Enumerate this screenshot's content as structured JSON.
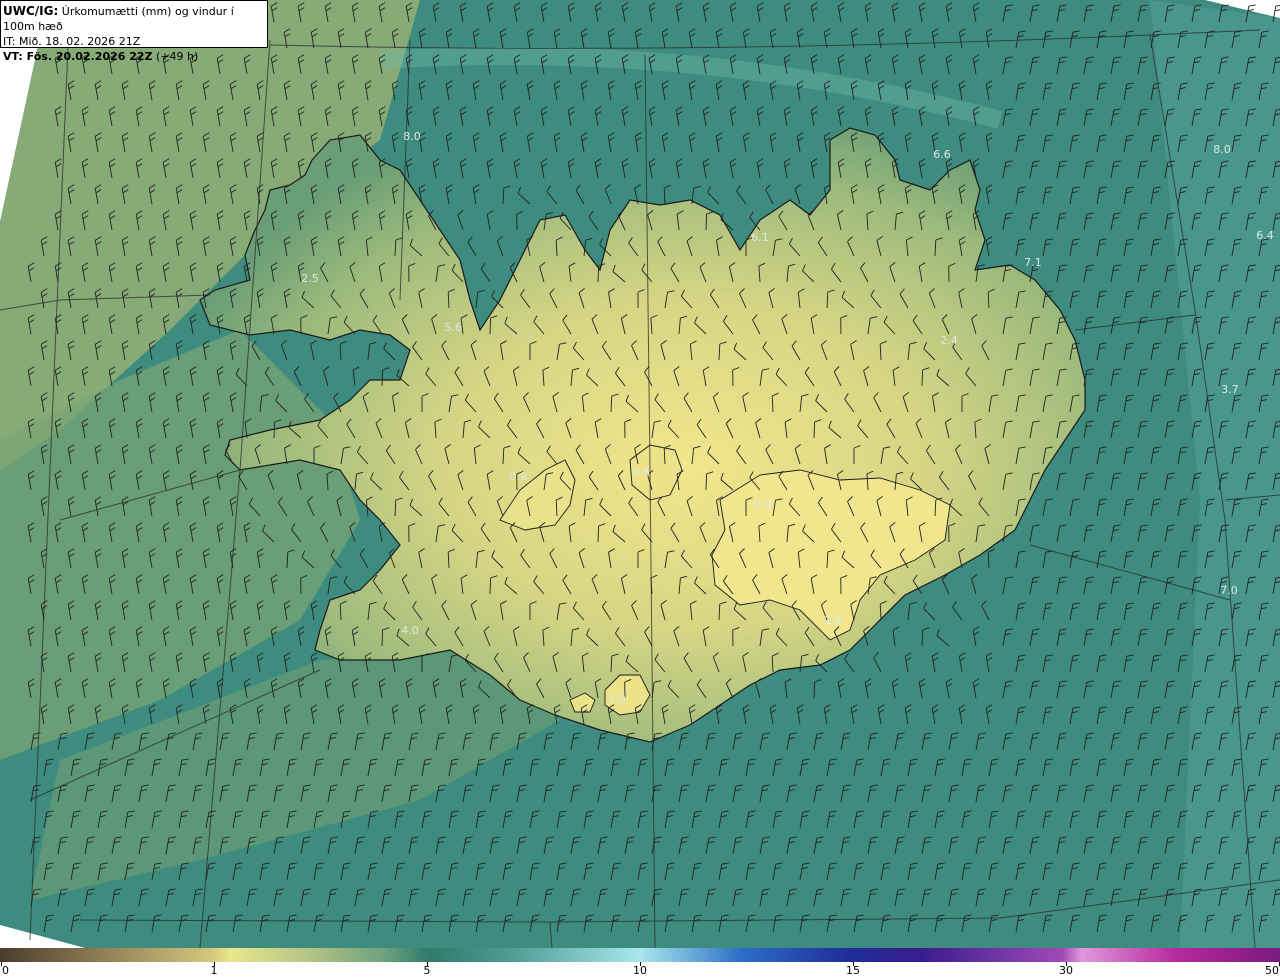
{
  "header": {
    "source": "UWC/IG:",
    "title": "Úrkomumætti (mm) og vindur í 100m hæð",
    "init_time": "IT: Mið. 18. 02. 2026 21Z",
    "valid_label": "VT: Fös. 20.02.2026 22Z",
    "valid_offset": "(+49 h)"
  },
  "map": {
    "region": "Iceland",
    "variable": "precipitable water (mm)",
    "wind_barbs": true,
    "background_color": "#3e8c80",
    "land_color": "#b9c27a",
    "highland_color": "#ece288",
    "coastline_color": "#1a1a1a",
    "value_labels": [
      "8.0",
      "6.6",
      "8.0",
      "6.1",
      "6.4",
      "7.1",
      "2.5",
      "5.6",
      "2.4",
      "3.7",
      "0.9",
      "0.6",
      "0.9",
      "7.0",
      "2.6",
      "4.0",
      "1.0"
    ]
  },
  "colorbar": {
    "ticks": [
      {
        "label": "0",
        "value": 0
      },
      {
        "label": "1",
        "value": 1
      },
      {
        "label": "5",
        "value": 5
      },
      {
        "label": "10",
        "value": 10
      },
      {
        "label": "15",
        "value": 15
      },
      {
        "label": "30",
        "value": 30
      },
      {
        "label": "50",
        "value": 50
      }
    ]
  }
}
